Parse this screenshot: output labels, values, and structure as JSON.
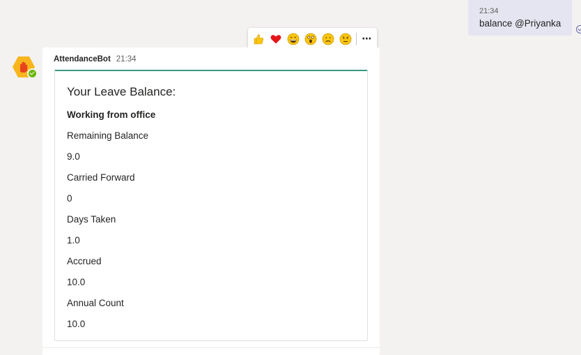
{
  "sent_message": {
    "time": "21:34",
    "text": "balance @Priyanka"
  },
  "reactions": {
    "icons": [
      "thumbs-up-icon",
      "heart-icon",
      "laugh-icon",
      "surprised-icon",
      "sad-icon",
      "angry-icon"
    ],
    "more_label": "⋯"
  },
  "message": {
    "sender": "AttendanceBot",
    "time": "21:34",
    "card": {
      "title": "Your Leave Balance:",
      "subtitle": "Working from office",
      "fields": [
        {
          "label": "Remaining Balance",
          "value": "9.0"
        },
        {
          "label": "Carried Forward",
          "value": "0"
        },
        {
          "label": "Days Taken",
          "value": "1.0"
        },
        {
          "label": "Accrued",
          "value": "10.0"
        },
        {
          "label": "Annual Count",
          "value": "10.0"
        }
      ]
    }
  },
  "colors": {
    "background": "#f3f2f1",
    "sent_bubble": "#e5e5f1",
    "card_accent": "#3a9a7f",
    "avatar": "#f8b51c",
    "presence": "#6bb700"
  }
}
